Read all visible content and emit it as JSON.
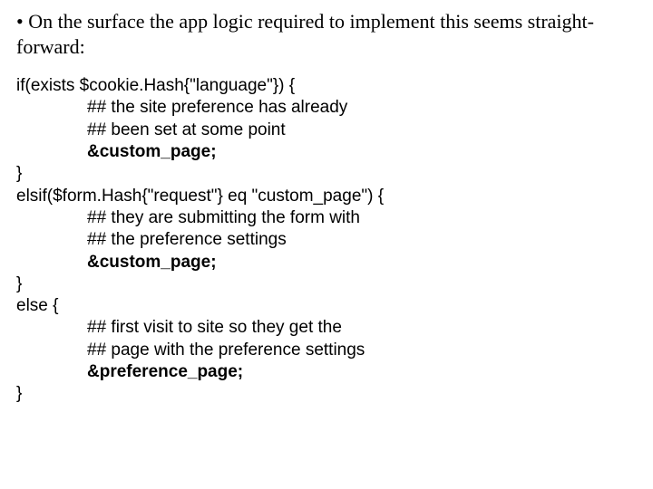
{
  "bullet": "• On the surface the app logic required to implement this seems straight-forward:",
  "code": {
    "l1": "if(exists $cookie.Hash{\"language\"}) {",
    "l2": "## the site preference has already",
    "l3": "## been set at some point",
    "l4": "&custom_page;",
    "l5": "}",
    "l6": "elsif($form.Hash{\"request\"} eq \"custom_page\") {",
    "l7": "## they are submitting the form with",
    "l8": "## the preference settings",
    "l9": "&custom_page;",
    "l10": "}",
    "l11": "else {",
    "l12": "## first visit to site so they get the",
    "l13": "## page with the preference settings",
    "l14": "&preference_page;",
    "l15": "}"
  }
}
